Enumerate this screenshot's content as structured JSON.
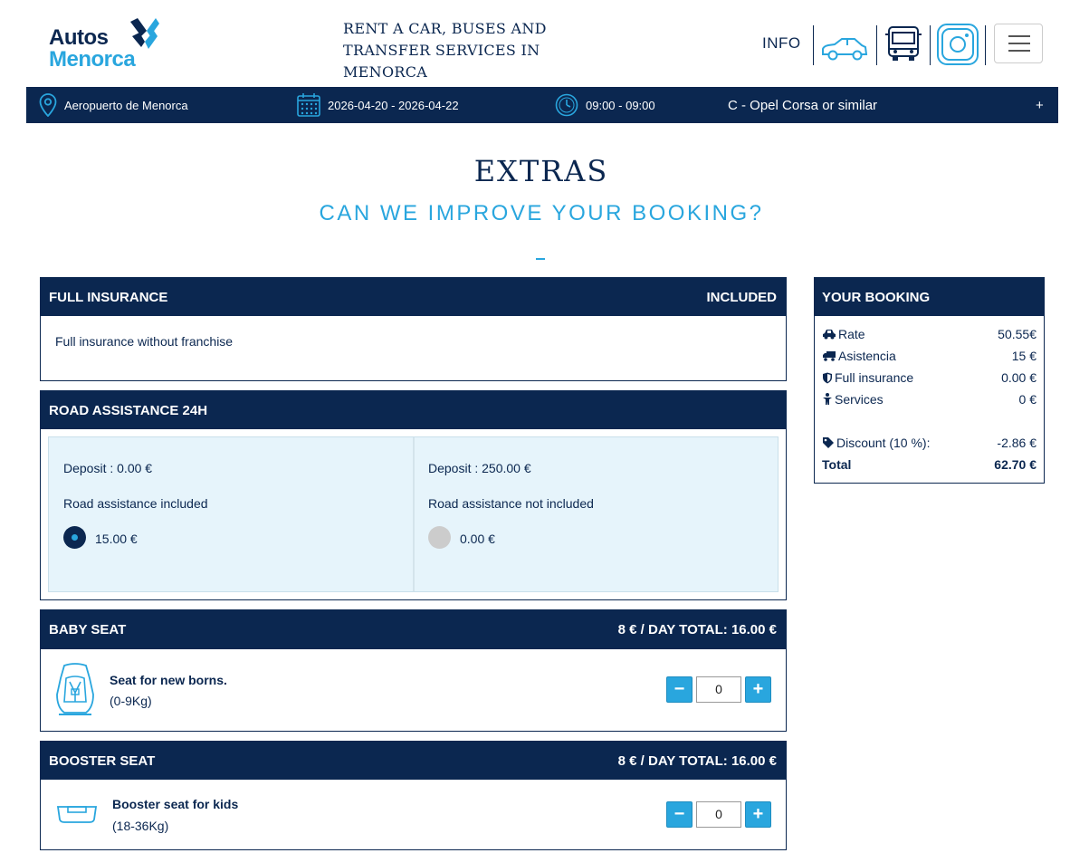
{
  "header": {
    "logo_line1": "Autos",
    "logo_line2": "Menorca",
    "tagline_line1": "RENT A CAR, BUSES AND",
    "tagline_line2": "TRANSFER SERVICES IN MENORCA",
    "info_label": "INFO",
    "icons": [
      "car-icon",
      "bus-icon",
      "instagram-icon",
      "hamburger-menu-icon"
    ]
  },
  "booking_bar": {
    "location": "Aeropuerto de Menorca",
    "dates": "2026-04-20 - 2026-04-22",
    "times": "09:00 - 09:00",
    "car": "C - Opel Corsa or similar",
    "expand": "+"
  },
  "page": {
    "title": "EXTRAS",
    "subtitle": "CAN WE IMPROVE YOUR BOOKING?"
  },
  "full_insurance": {
    "title": "FULL INSURANCE",
    "status": "INCLUDED",
    "description": "Full insurance without franchise"
  },
  "road_assistance": {
    "title": "ROAD ASSISTANCE 24H",
    "options": [
      {
        "deposit": "Deposit : 0.00 €",
        "label": "Road assistance included",
        "price": "15.00 €",
        "selected": true
      },
      {
        "deposit": "Deposit : 250.00 €",
        "label": "Road assistance not included",
        "price": "0.00 €",
        "selected": false
      }
    ]
  },
  "baby_seat": {
    "title": "BABY SEAT",
    "price": "8 € / DAY TOTAL: 16.00 €",
    "name": "Seat for new borns.",
    "weight": "(0-9Kg)",
    "quantity": "0",
    "minus": "−",
    "plus": "+"
  },
  "booster_seat": {
    "title": "BOOSTER SEAT",
    "price": "8 € / DAY TOTAL: 16.00 €",
    "name": "Booster seat for kids",
    "weight": "(18-36Kg)",
    "quantity": "0",
    "minus": "−",
    "plus": "+"
  },
  "summary": {
    "title": "YOUR BOOKING",
    "rows": [
      {
        "label": "Rate",
        "value": "50.55€",
        "icon": "car-icon"
      },
      {
        "label": "Asistencia",
        "value": "15 €",
        "icon": "truck-icon"
      },
      {
        "label": "Full insurance",
        "value": "0.00 €",
        "icon": "shield-icon"
      },
      {
        "label": "Services",
        "value": "0 €",
        "icon": "person-icon"
      }
    ],
    "discount_label": "Discount (10 %):",
    "discount_value": "-2.86 €",
    "total_label": "Total",
    "total_value": "62.70 €"
  },
  "colors": {
    "navy": "#0b2750",
    "accent": "#29a6de",
    "option_bg": "#e6f4fb"
  }
}
